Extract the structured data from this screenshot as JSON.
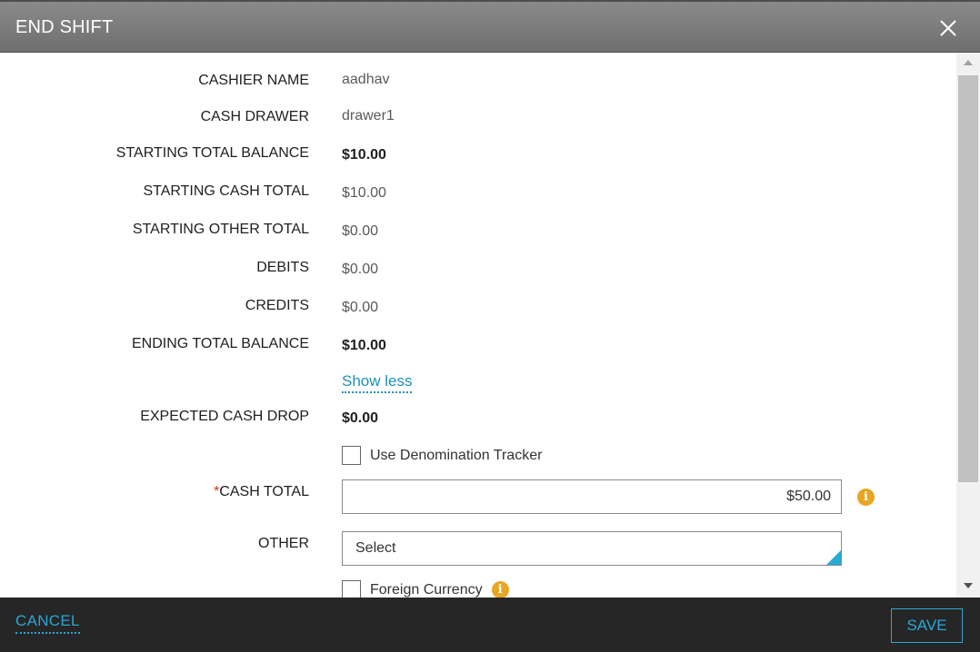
{
  "dialog": {
    "title": "END SHIFT"
  },
  "fields": {
    "cashier_name": {
      "label": "CASHIER NAME",
      "value": "aadhav"
    },
    "cash_drawer": {
      "label": "CASH DRAWER",
      "value": "drawer1"
    },
    "starting_total_balance": {
      "label": "STARTING TOTAL BALANCE",
      "value": "$10.00"
    },
    "starting_cash_total": {
      "label": "STARTING CASH TOTAL",
      "value": "$10.00"
    },
    "starting_other_total": {
      "label": "STARTING OTHER TOTAL",
      "value": "$0.00"
    },
    "debits": {
      "label": "DEBITS",
      "value": "$0.00"
    },
    "credits": {
      "label": "CREDITS",
      "value": "$0.00"
    },
    "ending_total_balance": {
      "label": "ENDING TOTAL BALANCE",
      "value": "$10.00"
    },
    "show_less": "Show less",
    "expected_cash_drop": {
      "label": "EXPECTED CASH DROP",
      "value": "$0.00"
    },
    "denomination_tracker": {
      "label": "Use Denomination Tracker",
      "checked": false
    },
    "cash_total": {
      "required_mark": "*",
      "label": "CASH TOTAL",
      "value": "$50.00"
    },
    "other": {
      "label": "OTHER",
      "selected": "Select"
    },
    "foreign_currency": {
      "label": "Foreign Currency",
      "checked": false
    }
  },
  "footer": {
    "cancel_label": "CANCEL",
    "save_label": "SAVE"
  },
  "colors": {
    "accent": "#2aa7d6",
    "info": "#e8a623",
    "header_bg": "#7a7a7a",
    "footer_bg": "#262626"
  },
  "icons": {
    "close": "close-icon",
    "info": "info-icon"
  }
}
